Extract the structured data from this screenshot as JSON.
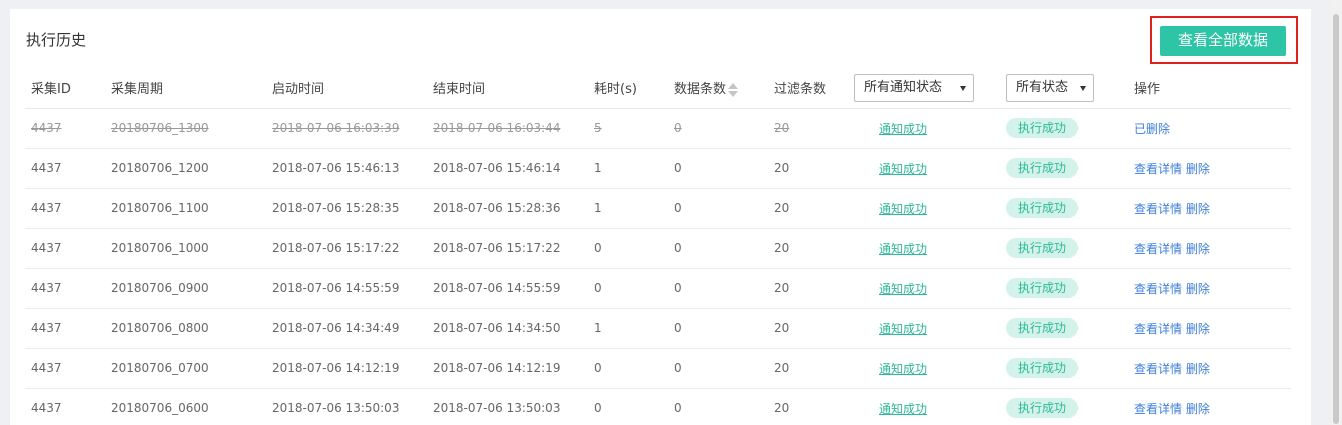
{
  "title": "执行历史",
  "view_all_button": "查看全部数据",
  "columns": {
    "id": "采集ID",
    "period": "采集周期",
    "start": "启动时间",
    "end": "结束时间",
    "duration": "耗时(s)",
    "count": "数据条数",
    "filter": "过滤条数",
    "notify_filter": "所有通知状态",
    "status_filter": "所有状态",
    "action": "操作"
  },
  "rows": [
    {
      "id": "4437",
      "period": "20180706_1300",
      "start": "2018-07-06 16:03:39",
      "end": "2018-07-06 16:03:44",
      "duration": "5",
      "count": "0",
      "filter": "20",
      "notify": "通知成功",
      "status": "执行成功",
      "deleted": true,
      "deleted_label": "已删除"
    },
    {
      "id": "4437",
      "period": "20180706_1200",
      "start": "2018-07-06 15:46:13",
      "end": "2018-07-06 15:46:14",
      "duration": "1",
      "count": "0",
      "filter": "20",
      "notify": "通知成功",
      "status": "执行成功",
      "detail": "查看详情",
      "delete": "删除"
    },
    {
      "id": "4437",
      "period": "20180706_1100",
      "start": "2018-07-06 15:28:35",
      "end": "2018-07-06 15:28:36",
      "duration": "1",
      "count": "0",
      "filter": "20",
      "notify": "通知成功",
      "status": "执行成功",
      "detail": "查看详情",
      "delete": "删除"
    },
    {
      "id": "4437",
      "period": "20180706_1000",
      "start": "2018-07-06 15:17:22",
      "end": "2018-07-06 15:17:22",
      "duration": "0",
      "count": "0",
      "filter": "20",
      "notify": "通知成功",
      "status": "执行成功",
      "detail": "查看详情",
      "delete": "删除"
    },
    {
      "id": "4437",
      "period": "20180706_0900",
      "start": "2018-07-06 14:55:59",
      "end": "2018-07-06 14:55:59",
      "duration": "0",
      "count": "0",
      "filter": "20",
      "notify": "通知成功",
      "status": "执行成功",
      "detail": "查看详情",
      "delete": "删除"
    },
    {
      "id": "4437",
      "period": "20180706_0800",
      "start": "2018-07-06 14:34:49",
      "end": "2018-07-06 14:34:50",
      "duration": "1",
      "count": "0",
      "filter": "20",
      "notify": "通知成功",
      "status": "执行成功",
      "detail": "查看详情",
      "delete": "删除"
    },
    {
      "id": "4437",
      "period": "20180706_0700",
      "start": "2018-07-06 14:12:19",
      "end": "2018-07-06 14:12:19",
      "duration": "0",
      "count": "0",
      "filter": "20",
      "notify": "通知成功",
      "status": "执行成功",
      "detail": "查看详情",
      "delete": "删除"
    },
    {
      "id": "4437",
      "period": "20180706_0600",
      "start": "2018-07-06 13:50:03",
      "end": "2018-07-06 13:50:03",
      "duration": "0",
      "count": "0",
      "filter": "20",
      "notify": "通知成功",
      "status": "执行成功",
      "detail": "查看详情",
      "delete": "删除"
    }
  ],
  "colors": {
    "accent": "#2ec4a6",
    "highlight": "#e02020",
    "link": "#3f7fd9",
    "badge_bg": "#d3f3ea"
  }
}
